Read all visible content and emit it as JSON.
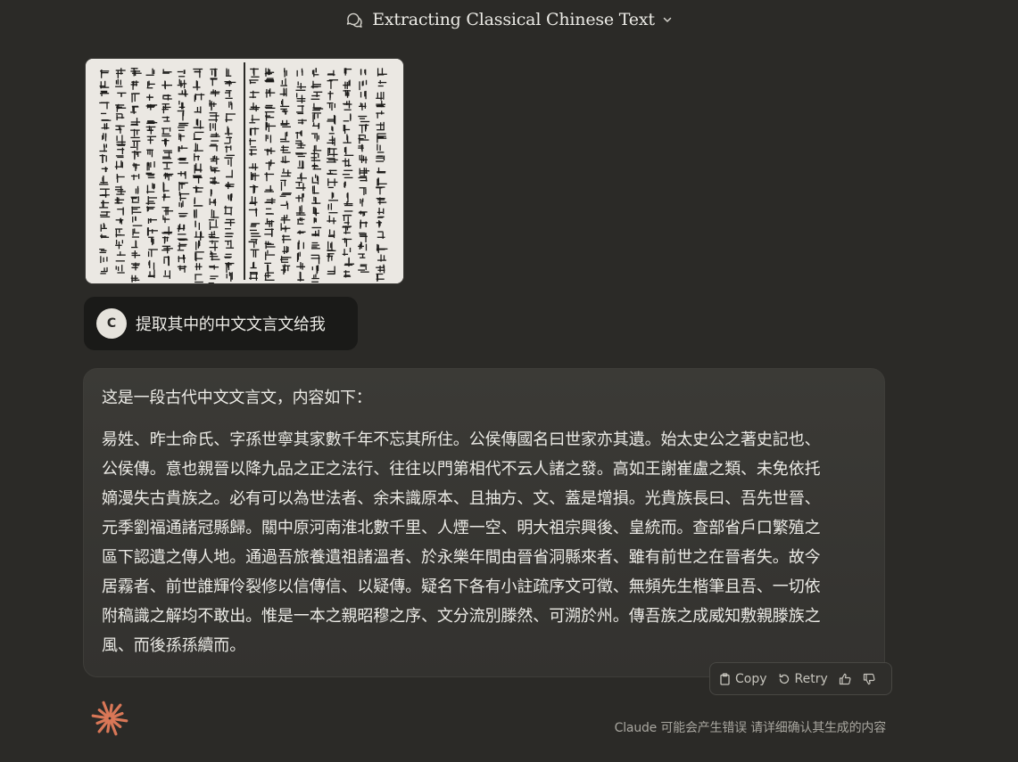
{
  "header": {
    "title": "Extracting Classical Chinese Text",
    "icon": "chat-bubbles-icon",
    "menu_icon": "chevron-down-icon"
  },
  "upload": {
    "kind": "scanned classical Chinese manuscript page",
    "icon": "image"
  },
  "user_message": {
    "avatar_letter": "C",
    "text": "提取其中的中文文言文给我"
  },
  "assistant_message": {
    "intro": "这是一段古代中文文言文，内容如下：",
    "classical_text": "昜姓、昨士命氏、字孫世寧其家數千年不忘其所住。公侯傳國名曰世家亦其遺。始太史公之著史記也、公侯傳。意也親晉以降九品之正之法行、往往以門第相代不云人諸之發。高如王謝崔盧之類、未免依托嫡漫失古貴族之。必有可以為世法者、余未識原本、且抽方、文、蓋是增損。光貴族長曰、吾先世晉、元季劉福通諸冠縣歸。關中原河南淮北數千里、人煙一空、明大祖宗興後、皇統而。查部省戶口繁殖之區下認遺之傳人地。通過吾旅養遺祖諸溫者、於永樂年間由晉省洞縣來者、雖有前世之在晉者失。故今居霧者、前世誰輝伶裂修以信傳信、以疑傳。疑名下各有小註疏序文可徵、無頻先生楷筆且吾、一切依附稿識之解均不敢出。惟是一本之親昭穆之序、文分流別滕然、可溯於州。傳吾族之成威知敷親滕族之風、而後孫孫續而。"
  },
  "actions": {
    "copy_label": "Copy",
    "retry_label": "Retry",
    "copy_icon": "clipboard-icon",
    "retry_icon": "retry-icon",
    "thumbs_up_icon": "thumbs-up-icon",
    "thumbs_down_icon": "thumbs-down-icon"
  },
  "footer": {
    "disclaimer": "Claude 可能会产生错误 请详细确认其生成的内容",
    "logo_icon": "claude-spark-icon"
  },
  "colors": {
    "background": "#2b2a27",
    "user_bubble": "#1a1a18",
    "assistant_bubble": "#383734",
    "text": "#ecebe6",
    "muted": "#a8a69f",
    "accent": "#d97757"
  }
}
